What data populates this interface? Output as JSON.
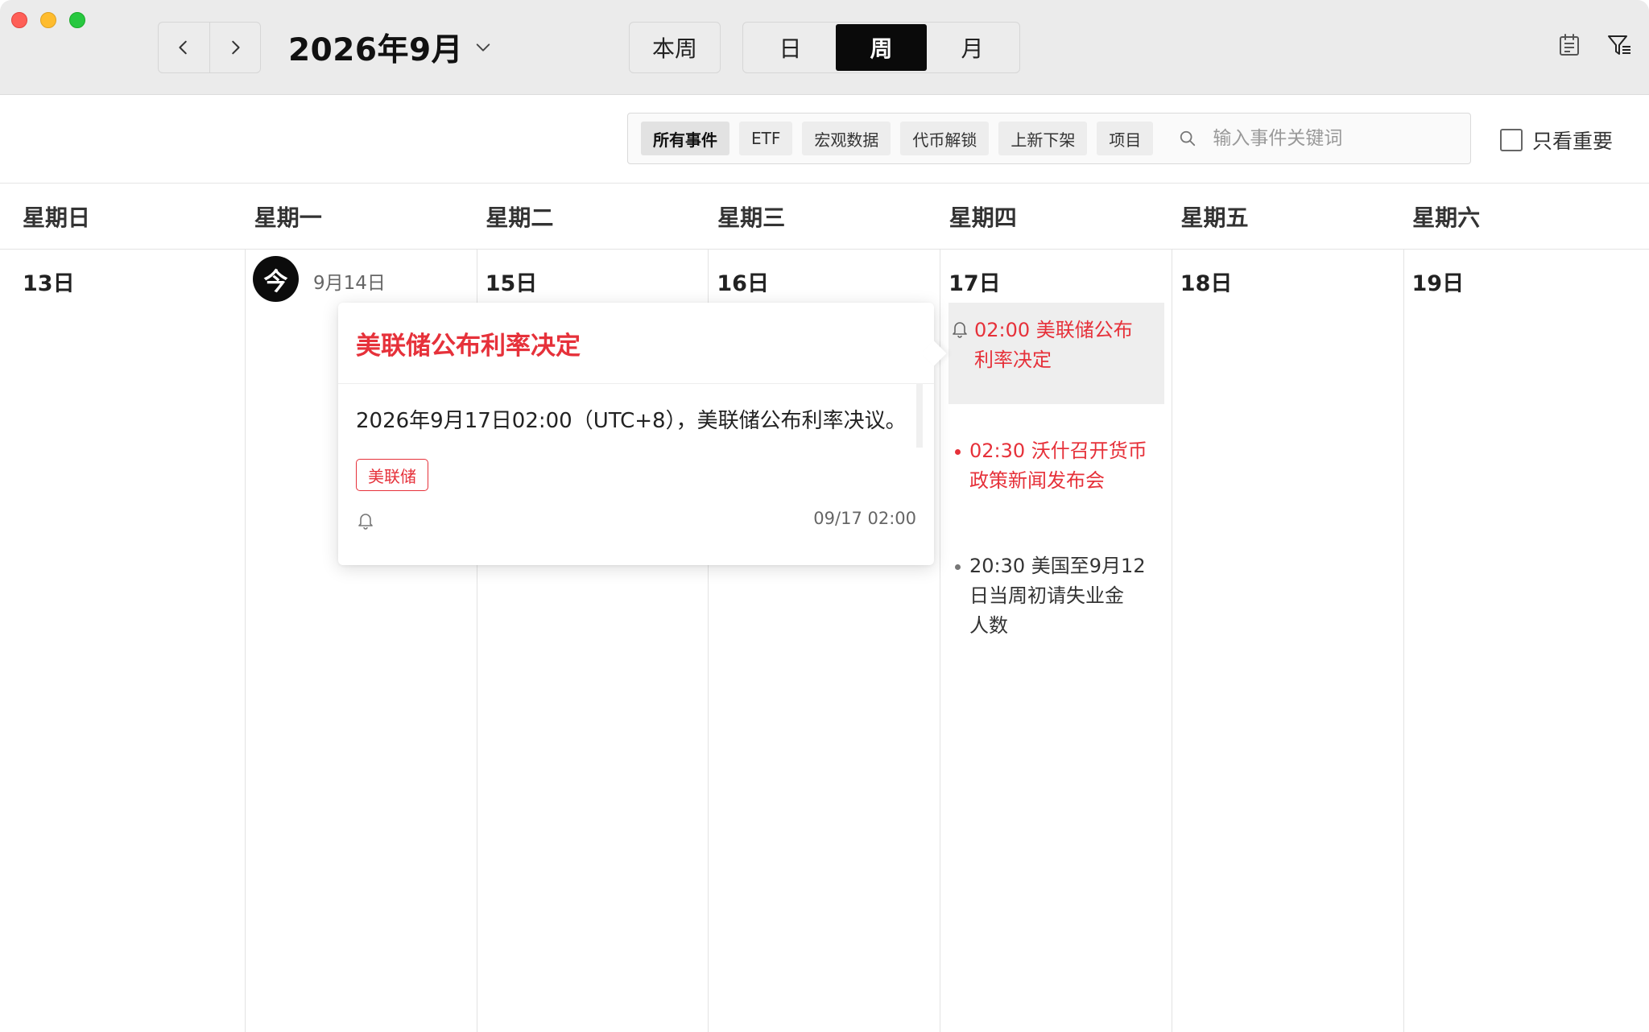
{
  "colors": {
    "accent_red": "#e6313a",
    "active_segment": "#0a0a0a"
  },
  "toolbar": {
    "month_title": "2026年9月",
    "this_week_label": "本周",
    "view_modes": [
      "日",
      "周",
      "月"
    ],
    "active_view": "周"
  },
  "filters": {
    "chips": [
      "所有事件",
      "ETF",
      "宏观数据",
      "代币解锁",
      "上新下架",
      "项目"
    ],
    "active_chip": "所有事件",
    "search_placeholder": "输入事件关键词",
    "important_only_label": "只看重要"
  },
  "weekdays": [
    "星期日",
    "星期一",
    "星期二",
    "星期三",
    "星期四",
    "星期五",
    "星期六"
  ],
  "days": [
    "13日",
    "9月14日",
    "15日",
    "16日",
    "17日",
    "18日",
    "19日"
  ],
  "today_badge": "今",
  "events": [
    {
      "text": "02:00 美联储公布利率决定",
      "line1": "02:00 美联储公布",
      "line2": "利率决定",
      "style": "selected"
    },
    {
      "text": "02:30 沃什召开货币政策新闻发布会",
      "line1": "02:30 沃什召开货币",
      "line2": "政策新闻发布会",
      "style": "red"
    },
    {
      "text": "20:30 美国至9月12日当周初请失业金人数",
      "line1": "20:30 美国至9月12",
      "line2": "日当周初请失业金",
      "line3": "人数",
      "style": "gray"
    }
  ],
  "popover": {
    "title": "美联储公布利率决定",
    "description": "2026年9月17日02:00（UTC+8），美联储公布利率决议。",
    "tag": "美联储",
    "time": "09/17 02:00"
  }
}
